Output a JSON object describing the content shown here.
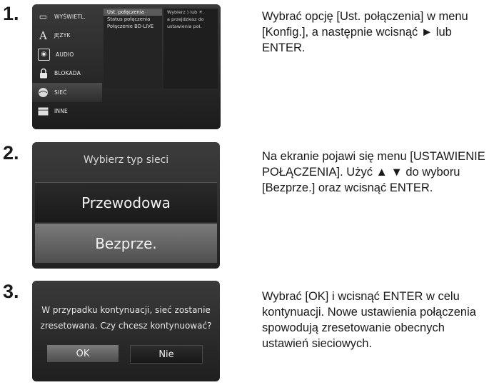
{
  "steps": [
    {
      "number": "1.",
      "description": "Wybrać opcję [Ust. połączenia] w menu [Konfig.], a następnie wcisnąć ► lub ENTER.",
      "screen": {
        "menu": [
          {
            "label": "WYŚWIETL.",
            "icon": "display-icon"
          },
          {
            "label": "JĘZYK",
            "icon": "language-icon"
          },
          {
            "label": "AUDIO",
            "icon": "audio-icon"
          },
          {
            "label": "BLOKADA",
            "icon": "lock-icon"
          },
          {
            "label": "SIEĆ",
            "icon": "network-icon"
          },
          {
            "label": "INNE",
            "icon": "other-icon"
          }
        ],
        "submenu": [
          "Ust. połączenia",
          "Status połączenia",
          "Połączenie BD-LIVE"
        ],
        "hint": [
          "Wybierz ) lub ☀.",
          "a przejdziesz do",
          "ustawienia poł."
        ]
      }
    },
    {
      "number": "2.",
      "description": "Na ekranie pojawi się menu [USTAWIENIE POŁĄCZENIA]. Użyć ▲ ▼ do wyboru [Bezprze.] oraz wcisnąć ENTER.",
      "screen": {
        "title": "Wybierz typ sieci",
        "options": [
          "Przewodowa",
          "Bezprze."
        ]
      }
    },
    {
      "number": "3.",
      "description": "Wybrać [OK] i wcisnąć ENTER w celu kontynuacji. Nowe ustawienia połączenia spowodują zresetowanie obecnych ustawień sieciowych.",
      "screen": {
        "message_line1": "W przypadku kontynuacji, sieć zostanie",
        "message_line2": "zresetowana. Czy chcesz kontynuować?",
        "ok_label": "OK",
        "no_label": "Nie"
      }
    }
  ]
}
